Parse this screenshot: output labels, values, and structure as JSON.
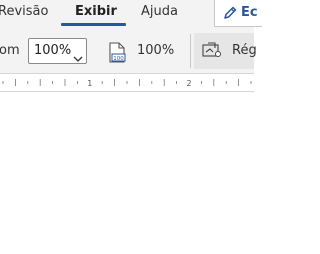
{
  "tabs": [
    {
      "label": "Revisão",
      "active": false
    },
    {
      "label": "Exibir",
      "active": true
    },
    {
      "label": "Ajuda",
      "active": false
    }
  ],
  "edit_button": {
    "label": "Ec",
    "icon": "pencil-icon"
  },
  "ribbon": {
    "left_fragment": "om",
    "zoom_select_value": "100%",
    "zoom_100_label": "100%",
    "region_label": "Rég"
  },
  "ruler": {
    "marks": [
      "1",
      "2"
    ]
  },
  "colors": {
    "accent": "#2b579a",
    "tab_bg": "#f3f3f3"
  }
}
